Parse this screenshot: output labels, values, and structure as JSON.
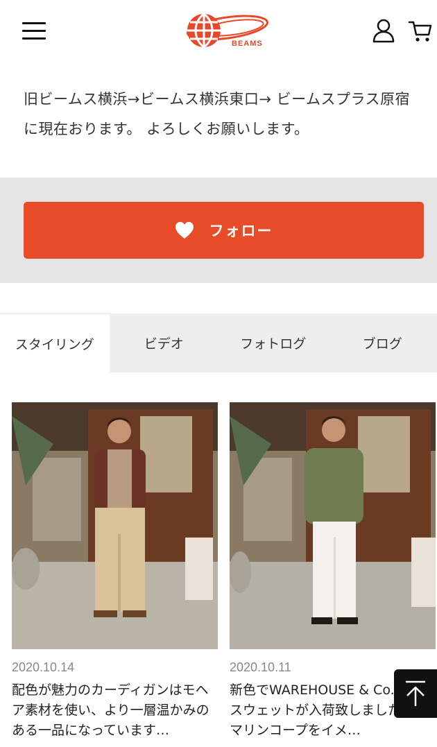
{
  "header": {
    "logo_text": "BEAMS",
    "menu_icon": "menu-icon",
    "user_icon": "user-icon",
    "cart_icon": "cart-icon",
    "brand_color": "#e8482a"
  },
  "bio": {
    "text": "旧ビームス横浜→ビームス横浜東口→ ビームスプラス原宿に現在おります。 よろしくお願いします。"
  },
  "follow": {
    "label": "フォロー",
    "icon": "heart-icon",
    "color": "#e84b27"
  },
  "tabs": [
    {
      "label": "スタイリング",
      "active": true
    },
    {
      "label": "ビデオ",
      "active": false
    },
    {
      "label": "フォトログ",
      "active": false
    },
    {
      "label": "ブログ",
      "active": false
    }
  ],
  "posts": [
    {
      "date": "2020.10.14",
      "description": "配色が魅力のカーディガンはモヘア素材を使い、より一層温かみのある一品になっています…"
    },
    {
      "date": "2020.10.11",
      "description": "新色でWAREHOUSE & Co.の別注スウェットが入荷致しました。USマリンコープをイメ…"
    }
  ],
  "scroll_top_icon": "arrow-up-icon"
}
